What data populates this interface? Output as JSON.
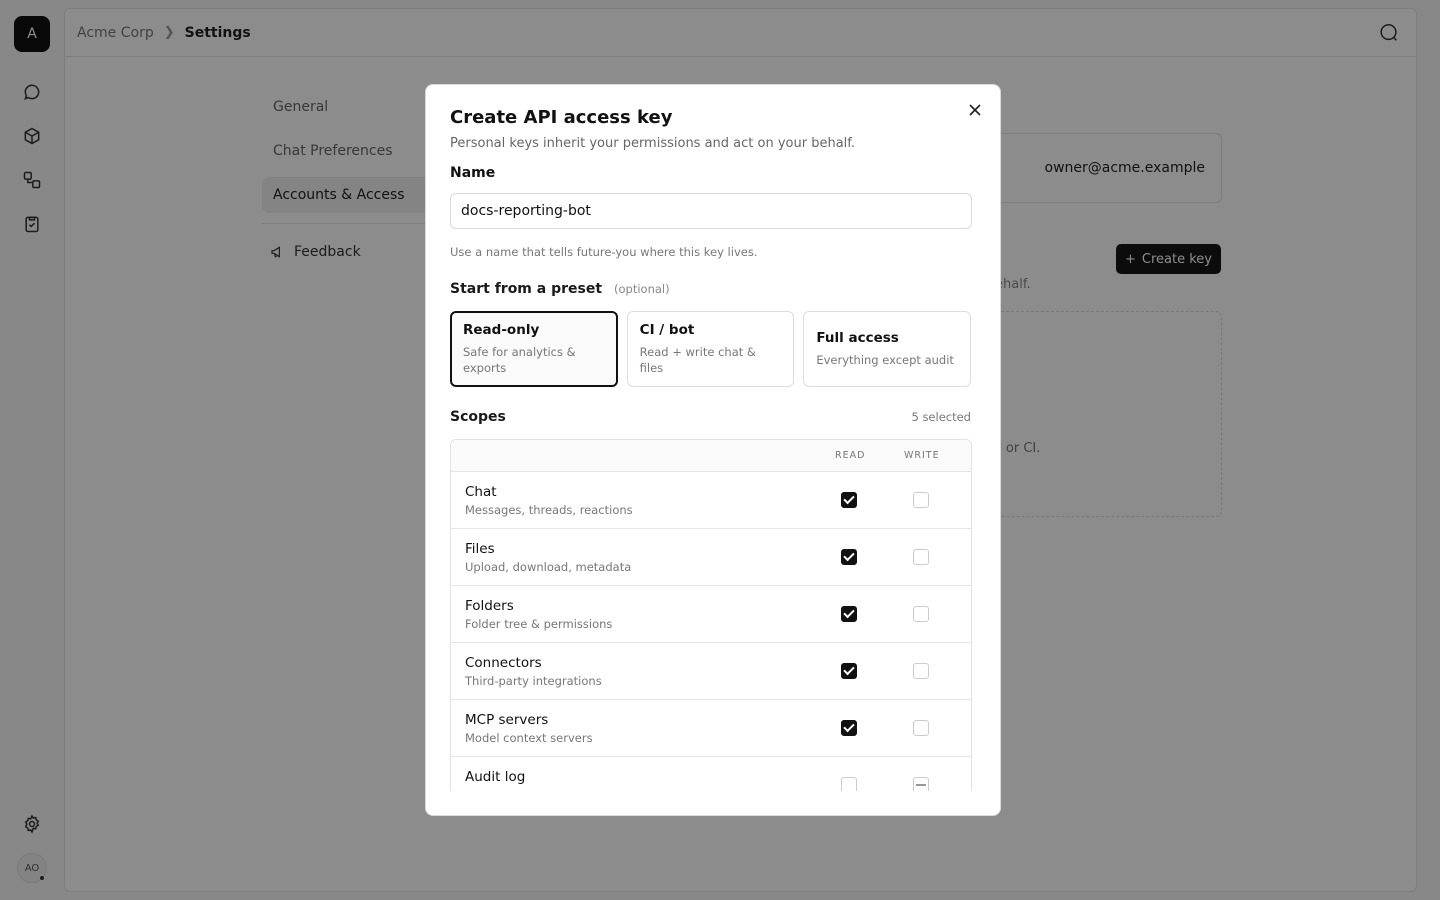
{
  "rail": {
    "logo_letter": "A",
    "avatar_initials": "AO"
  },
  "topbar": {
    "org": "Acme Corp",
    "current": "Settings"
  },
  "settings_nav": {
    "items": [
      {
        "label": "General"
      },
      {
        "label": "Chat Preferences"
      },
      {
        "label": "Accounts & Access"
      }
    ],
    "feedback": "Feedback"
  },
  "background": {
    "owner_email": "owner@acme.example",
    "create_key_label": "Create key",
    "behalf_fragment": "ehalf.",
    "ci_fragment": "s or CI."
  },
  "modal": {
    "title": "Create API access key",
    "subtitle": "Personal keys inherit your permissions and act on your behalf.",
    "name_label": "Name",
    "name_value": "docs-reporting-bot",
    "name_hint": "Use a name that tells future-you where this key lives.",
    "preset_label": "Start from a preset",
    "preset_optional": "(optional)",
    "presets": [
      {
        "title": "Read-only",
        "desc": "Safe for analytics & exports",
        "selected": true
      },
      {
        "title": "CI / bot",
        "desc": "Read + write chat & files",
        "selected": false
      },
      {
        "title": "Full access",
        "desc": "Everything except audit",
        "selected": false
      }
    ],
    "scopes_title": "Scopes",
    "scopes_count": "5 selected",
    "col_read": "READ",
    "col_write": "WRITE",
    "scopes": [
      {
        "name": "Chat",
        "desc": "Messages, threads, reactions",
        "read": true,
        "write": false
      },
      {
        "name": "Files",
        "desc": "Upload, download, metadata",
        "read": true,
        "write": false
      },
      {
        "name": "Folders",
        "desc": "Folder tree & permissions",
        "read": true,
        "write": false
      },
      {
        "name": "Connectors",
        "desc": "Third-party integrations",
        "read": true,
        "write": false
      },
      {
        "name": "MCP servers",
        "desc": "Model context servers",
        "read": true,
        "write": false
      },
      {
        "name": "Audit log",
        "desc": "",
        "read": false,
        "write": "indeterminate"
      }
    ]
  }
}
